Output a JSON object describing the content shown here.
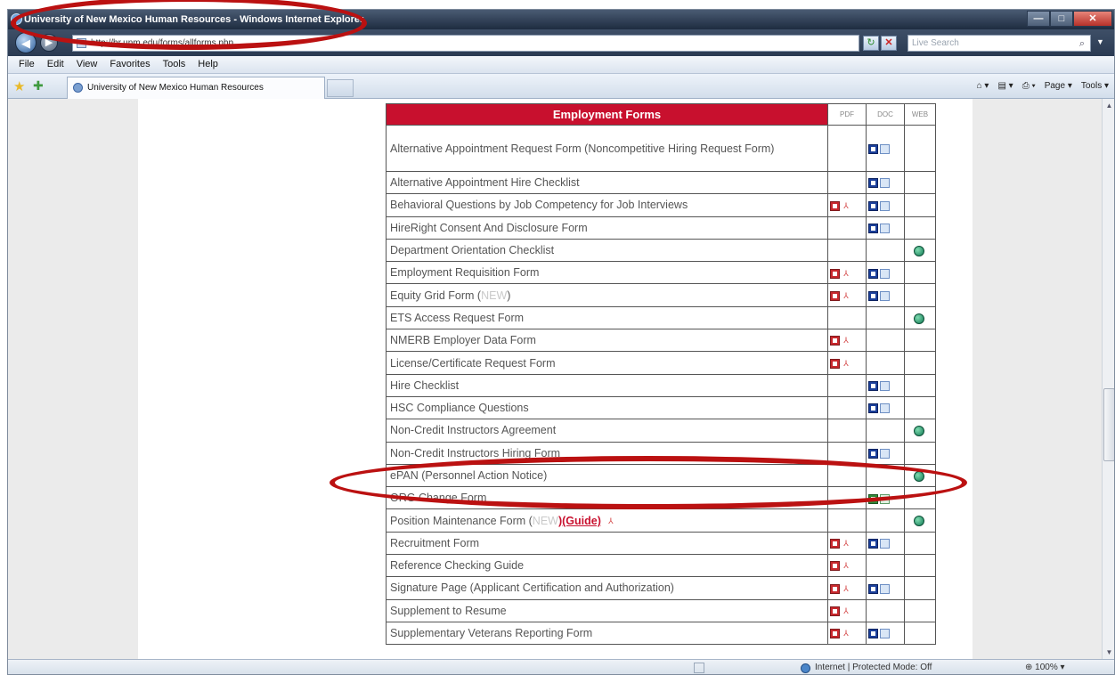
{
  "window": {
    "title": "University of New Mexico Human Resources - Windows Internet Explorer",
    "buttons": {
      "minimize": "—",
      "maximize": "□",
      "close": "✕"
    }
  },
  "address_bar": {
    "url": "http://hr.unm.edu/forms/allforms.php",
    "search_placeholder": "Live Search"
  },
  "menu": [
    "File",
    "Edit",
    "View",
    "Favorites",
    "Tools",
    "Help"
  ],
  "tabs": [
    {
      "label": "University of New Mexico Human Resources",
      "active": true
    }
  ],
  "command_bar": [
    "Page ▾",
    "Tools ▾"
  ],
  "forms_table": {
    "title": "Employment Forms",
    "columns": [
      "PDF",
      "DOC",
      "WEB"
    ],
    "rows": [
      {
        "name": "Alternative Appointment Request Form (Noncompetitive Hiring Request Form)",
        "pdf": false,
        "doc": "word",
        "web": false
      },
      {
        "name": "Alternative Appointment Hire Checklist",
        "pdf": false,
        "doc": "word",
        "web": false
      },
      {
        "name": "Behavioral Questions by Job Competency for Job Interviews",
        "pdf": true,
        "doc": "word",
        "web": false
      },
      {
        "name": "HireRight Consent And Disclosure Form",
        "pdf": false,
        "doc": "word",
        "web": false
      },
      {
        "name": "Department Orientation Checklist",
        "pdf": false,
        "doc": false,
        "web": true
      },
      {
        "name": "Employment Requisition Form",
        "pdf": true,
        "doc": "word",
        "web": false
      },
      {
        "name": "Equity Grid Form (",
        "new": "NEW",
        "suffix": ")",
        "pdf": true,
        "doc": "word",
        "web": false
      },
      {
        "name": "ETS Access Request Form",
        "pdf": false,
        "doc": false,
        "web": true
      },
      {
        "name": "NMERB Employer Data Form",
        "pdf": true,
        "doc": false,
        "web": false
      },
      {
        "name": "License/Certificate Request Form",
        "pdf": true,
        "doc": false,
        "web": false
      },
      {
        "name": "Hire Checklist",
        "pdf": false,
        "doc": "word",
        "web": false
      },
      {
        "name": "HSC Compliance Questions",
        "pdf": false,
        "doc": "word",
        "web": false
      },
      {
        "name": "Non-Credit Instructors Agreement",
        "pdf": false,
        "doc": false,
        "web": true
      },
      {
        "name": "Non-Credit Instructors Hiring Form",
        "pdf": false,
        "doc": "word",
        "web": false
      },
      {
        "name": "ePAN (Personnel Action Notice)",
        "pdf": false,
        "doc": false,
        "web": true
      },
      {
        "name": "ORG Change Form",
        "pdf": false,
        "doc": "excel",
        "web": false
      },
      {
        "name": "Position Maintenance Form (",
        "new": "NEW",
        "guide": ")(Guide)",
        "pdf": false,
        "doc": false,
        "web": true
      },
      {
        "name": "Recruitment Form",
        "pdf": true,
        "doc": "word",
        "web": false
      },
      {
        "name": "Reference Checking Guide",
        "pdf": true,
        "doc": false,
        "web": false
      },
      {
        "name": "Signature Page (Applicant Certification and Authorization)",
        "pdf": true,
        "doc": "word",
        "web": false
      },
      {
        "name": "Supplement to Resume",
        "pdf": true,
        "doc": false,
        "web": false
      },
      {
        "name": "Supplementary Veterans Reporting Form",
        "pdf": true,
        "doc": "word",
        "web": false
      }
    ]
  },
  "status_bar": {
    "zone": "Internet | Protected Mode: Off",
    "zoom": "100%"
  },
  "colors": {
    "header_red": "#c8102e",
    "annotation_red": "#bb1111"
  }
}
